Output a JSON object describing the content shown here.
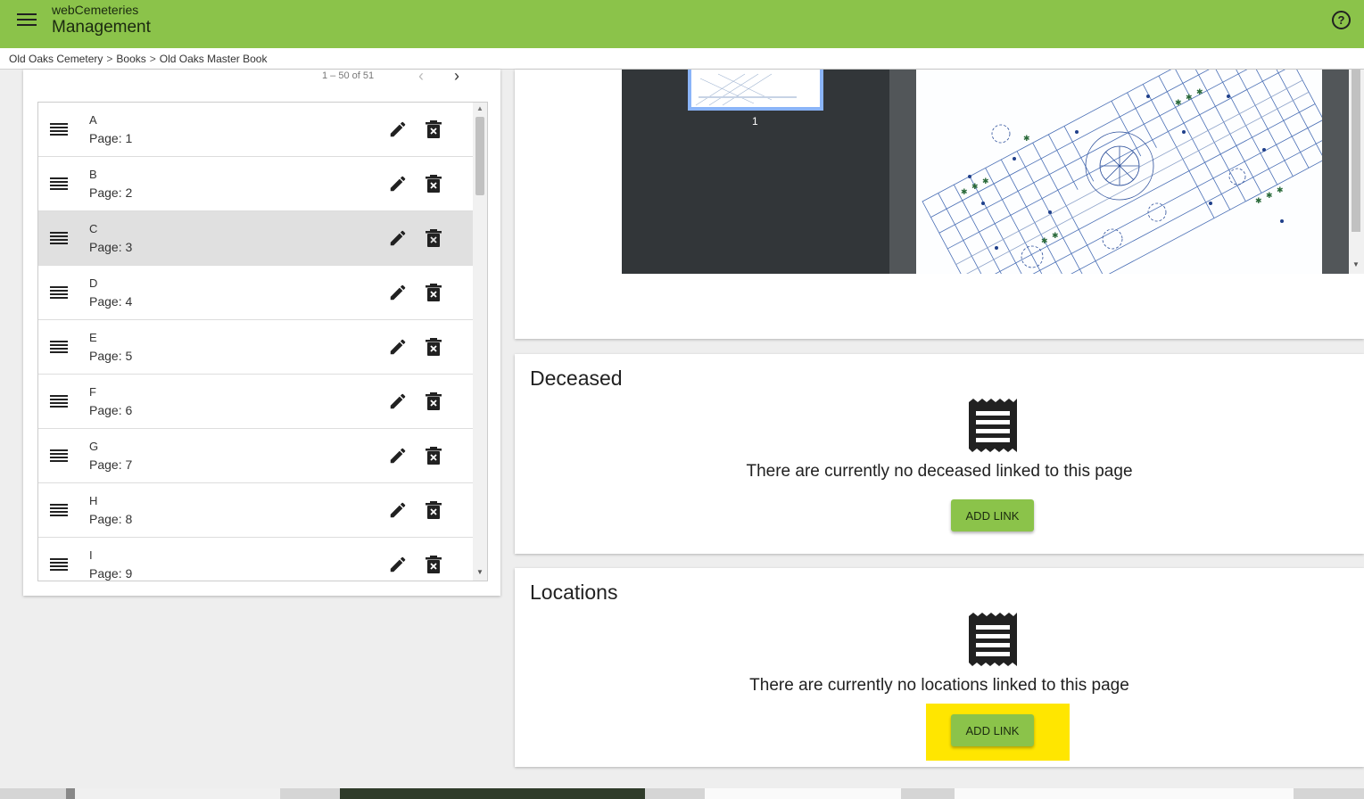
{
  "app": {
    "subtitle": "webCemeteries",
    "title": "Management"
  },
  "header": {
    "menu_icon": "menu-icon",
    "help_icon": "help-icon",
    "help_glyph": "?"
  },
  "breadcrumb": {
    "items": [
      "Old Oaks Cemetery",
      "Books",
      "Old Oaks Master Book"
    ],
    "separator": ">"
  },
  "paginator": {
    "range": "1 – 50 of 51",
    "prev": "‹",
    "next": "›"
  },
  "pages_list": {
    "items": [
      {
        "name": "A",
        "page": "Page: 1"
      },
      {
        "name": "B",
        "page": "Page: 2"
      },
      {
        "name": "C",
        "page": "Page: 3",
        "selected": true
      },
      {
        "name": "D",
        "page": "Page: 4"
      },
      {
        "name": "E",
        "page": "Page: 5"
      },
      {
        "name": "F",
        "page": "Page: 6"
      },
      {
        "name": "G",
        "page": "Page: 7"
      },
      {
        "name": "H",
        "page": "Page: 8"
      },
      {
        "name": "I",
        "page": "Page: 9"
      }
    ]
  },
  "viewer": {
    "thumbnail_page_number": "1"
  },
  "deceased": {
    "title": "Deceased",
    "empty_message": "There are currently no deceased linked to this page",
    "button": "ADD LINK",
    "icon": "receipt-icon"
  },
  "locations": {
    "title": "Locations",
    "empty_message": "There are currently no locations linked to this page",
    "button": "ADD LINK",
    "icon": "receipt-icon"
  },
  "colors": {
    "primary": "#8bc34a",
    "highlight": "#ffe600",
    "viewer_dark": "#323639"
  }
}
